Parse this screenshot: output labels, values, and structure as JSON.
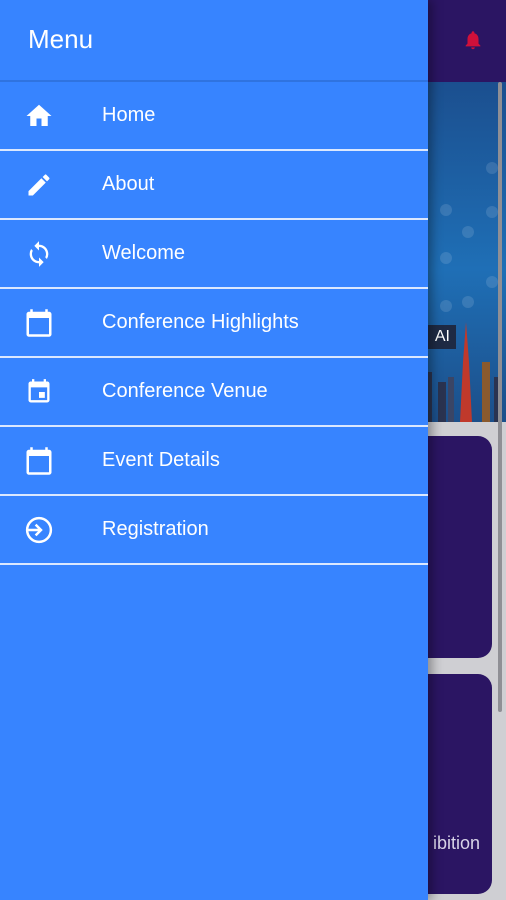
{
  "background": {
    "hero_tag": "AI",
    "card_text": "ibition",
    "header_color": "#2b1563",
    "bell_color": "#d0103a"
  },
  "drawer": {
    "title": "Menu",
    "background": "#3784ff",
    "items": [
      {
        "label": "Home",
        "icon": "home-icon"
      },
      {
        "label": "About",
        "icon": "pencil-icon"
      },
      {
        "label": "Welcome",
        "icon": "sync-icon"
      },
      {
        "label": "Conference Highlights",
        "icon": "calendar-icon"
      },
      {
        "label": "Conference Venue",
        "icon": "calendar-event-icon"
      },
      {
        "label": "Event Details",
        "icon": "calendar-icon"
      },
      {
        "label": "Registration",
        "icon": "login-icon"
      }
    ]
  }
}
